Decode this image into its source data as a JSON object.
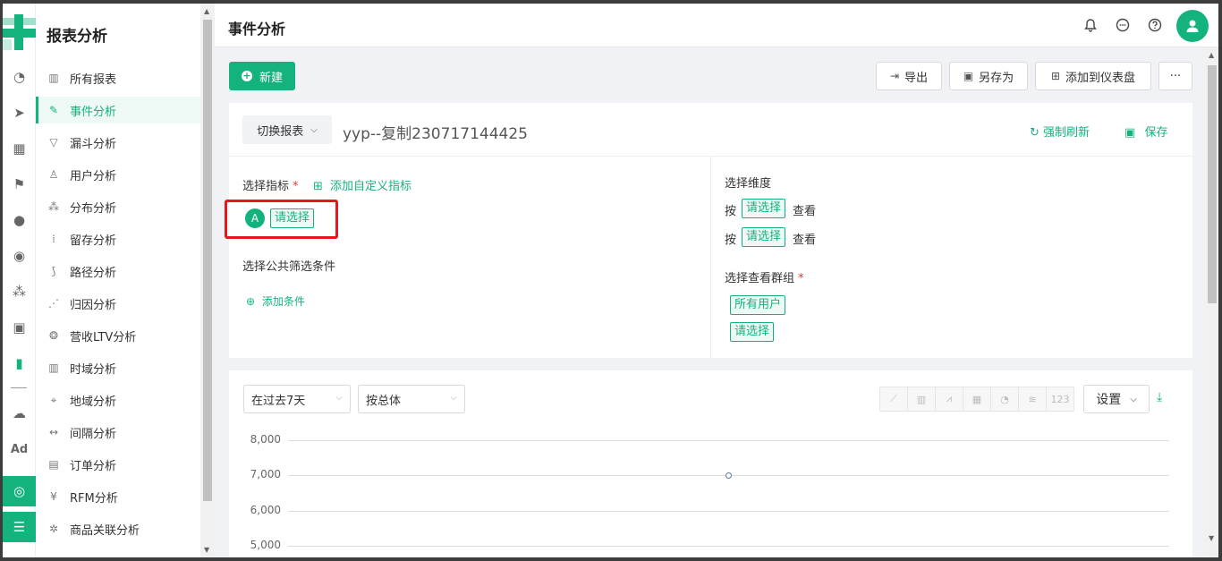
{
  "sidebar": {
    "title": "报表分析",
    "items": [
      {
        "label": "所有报表",
        "icon": "bar-chart-icon"
      },
      {
        "label": "事件分析",
        "icon": "edit-icon"
      },
      {
        "label": "漏斗分析",
        "icon": "funnel-icon"
      },
      {
        "label": "用户分析",
        "icon": "user-icon"
      },
      {
        "label": "分布分析",
        "icon": "distribution-icon"
      },
      {
        "label": "留存分析",
        "icon": "dots-grid-icon"
      },
      {
        "label": "路径分析",
        "icon": "path-icon"
      },
      {
        "label": "归因分析",
        "icon": "attribution-icon"
      },
      {
        "label": "营收LTV分析",
        "icon": "revenue-icon"
      },
      {
        "label": "时域分析",
        "icon": "time-chart-icon"
      },
      {
        "label": "地域分析",
        "icon": "location-icon"
      },
      {
        "label": "间隔分析",
        "icon": "interval-icon"
      },
      {
        "label": "订单分析",
        "icon": "clipboard-icon"
      },
      {
        "label": "RFM分析",
        "icon": "yen-icon"
      },
      {
        "label": "商品关联分析",
        "icon": "network-icon"
      }
    ]
  },
  "rail": {
    "ad_label": "Ad"
  },
  "header": {
    "title": "事件分析"
  },
  "toolbar": {
    "new_label": "新建",
    "export_label": "导出",
    "save_as_label": "另存为",
    "add_dashboard_label": "添加到仪表盘",
    "more_label": "···"
  },
  "report": {
    "switch_label": "切换报表",
    "name": "yyp--复制230717144425",
    "refresh_label": "强制刷新",
    "save_label": "保存"
  },
  "metrics": {
    "label": "选择指标",
    "add_custom_label": "添加自定义指标",
    "badge": "A",
    "select_label": "请选择",
    "filter_label": "选择公共筛选条件",
    "add_condition_label": "添加条件"
  },
  "dimensions": {
    "label": "选择维度",
    "prefix": "按",
    "select_label": "请选择",
    "suffix": "查看",
    "group_label": "选择查看群组",
    "all_users": "所有用户",
    "group_select": "请选择"
  },
  "chart": {
    "range_select": "在过去7天",
    "group_select": "按总体",
    "settings_label": "设置",
    "type_123": "123"
  },
  "chart_data": {
    "type": "line",
    "y_ticks": [
      "8,000",
      "7,000",
      "6,000",
      "5,000"
    ],
    "ylim": [
      5000,
      8000
    ],
    "series": [
      {
        "values": [
          7000
        ]
      }
    ],
    "grid": true
  },
  "colors": {
    "accent": "#14b37d",
    "highlight": "#e8151a"
  }
}
